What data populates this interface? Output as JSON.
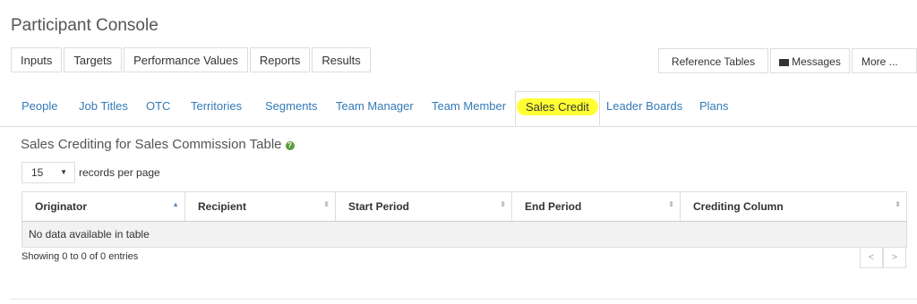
{
  "app": {
    "title": "Participant Console"
  },
  "topnav": {
    "items": [
      "Inputs",
      "Targets",
      "Performance Values",
      "Reports",
      "Results"
    ],
    "right": {
      "reference": "Reference Tables",
      "messages": "Messages",
      "more": "More ..."
    }
  },
  "tabs": [
    "People",
    "Job Titles",
    "OTC",
    "Territories",
    "Segments",
    "Team Manager",
    "Team Member",
    "Sales Credit",
    "Leader Boards",
    "Plans"
  ],
  "active_tab": "Sales Credit",
  "section": {
    "title": "Sales Crediting for Sales Commission Table",
    "help_glyph": "?"
  },
  "length": {
    "value": "15",
    "label": "records per page"
  },
  "table": {
    "columns": [
      "Originator",
      "Recipient",
      "Start Period",
      "End Period",
      "Crediting Column"
    ],
    "empty": "No data available in table"
  },
  "info": "Showing 0 to 0 of 0 entries",
  "pager": {
    "prev": "<",
    "next": ">"
  },
  "colors": {
    "link": "#337ab7",
    "highlight": "#ffff33",
    "help_icon": "#5b9b3a"
  }
}
